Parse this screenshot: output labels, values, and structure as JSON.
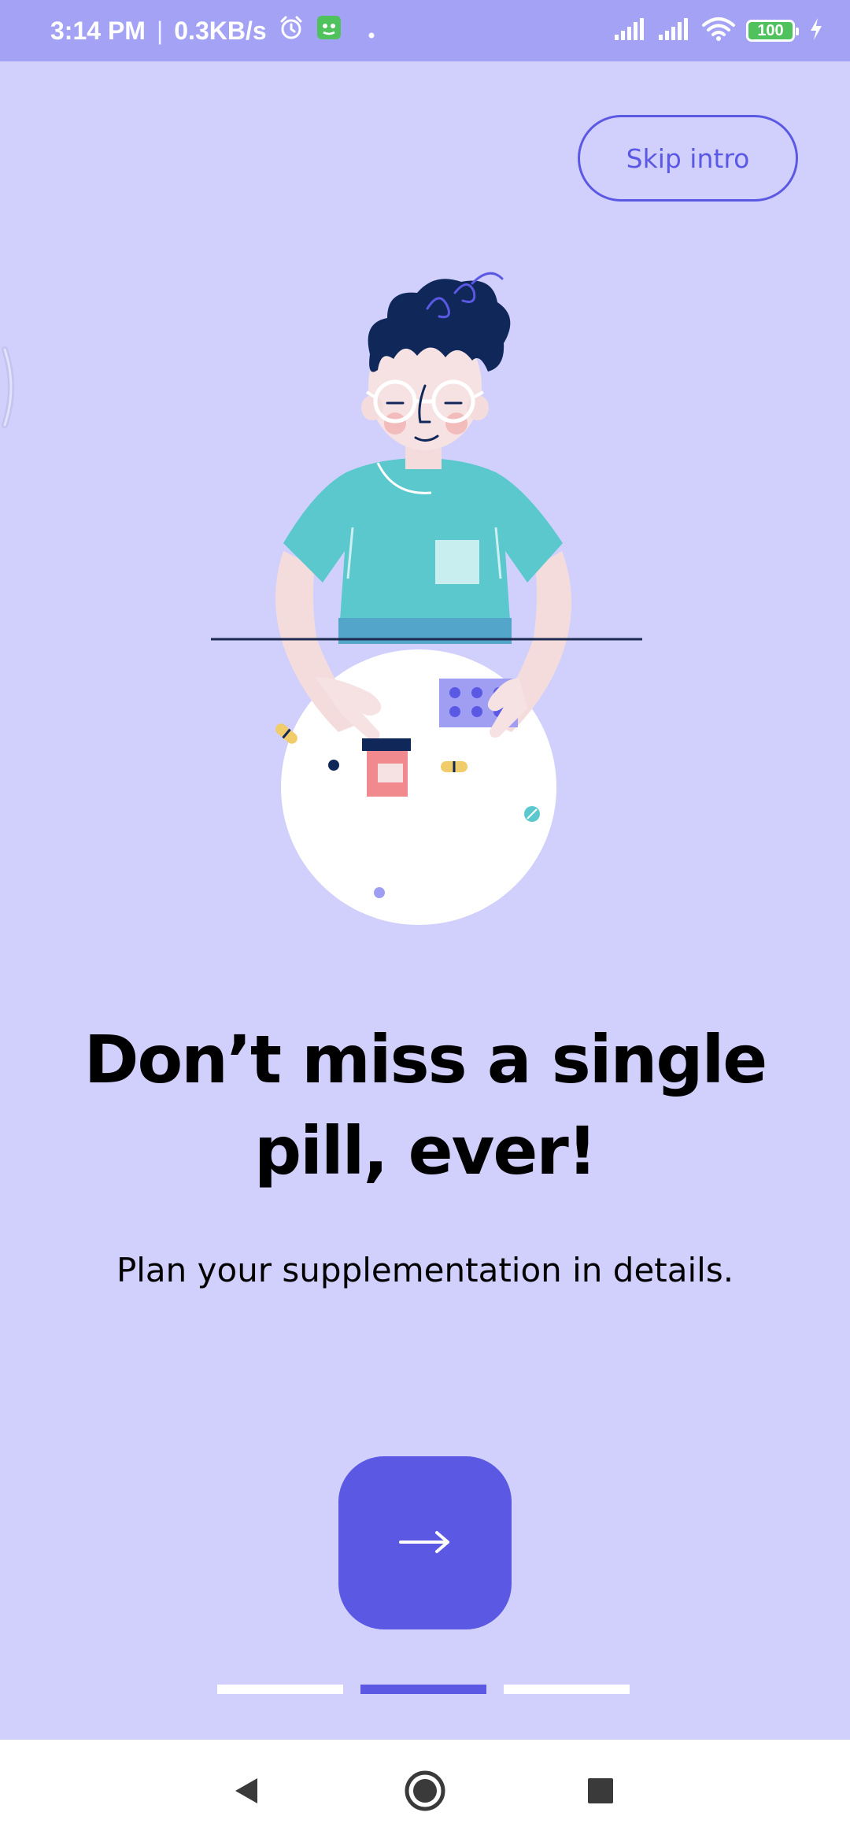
{
  "status_bar": {
    "time": "3:14 PM",
    "separator": "|",
    "network_speed": "0.3KB/s",
    "icons": [
      "alarm-icon",
      "app-notification-icon",
      "dot-icon",
      "signal-icon",
      "signal-icon",
      "wifi-icon",
      "battery-icon",
      "charging-icon"
    ],
    "battery_level": "100"
  },
  "onboarding": {
    "skip_label": "Skip intro",
    "headline": "Don’t miss a single pill, ever!",
    "subtitle": "Plan your supplementation in details.",
    "next_icon": "arrow-right-icon",
    "illustration_icon": "person-with-pills-illustration",
    "page_indicator": {
      "total": 3,
      "current": 2
    }
  },
  "navigation_bar": {
    "icons": [
      "back-icon",
      "home-icon",
      "recents-icon"
    ]
  },
  "colors": {
    "background": "#d1d0fd",
    "status_bar": "#a3a2f5",
    "accent": "#5b59e4",
    "text": "#000000",
    "nav_bar": "#ffffff"
  }
}
